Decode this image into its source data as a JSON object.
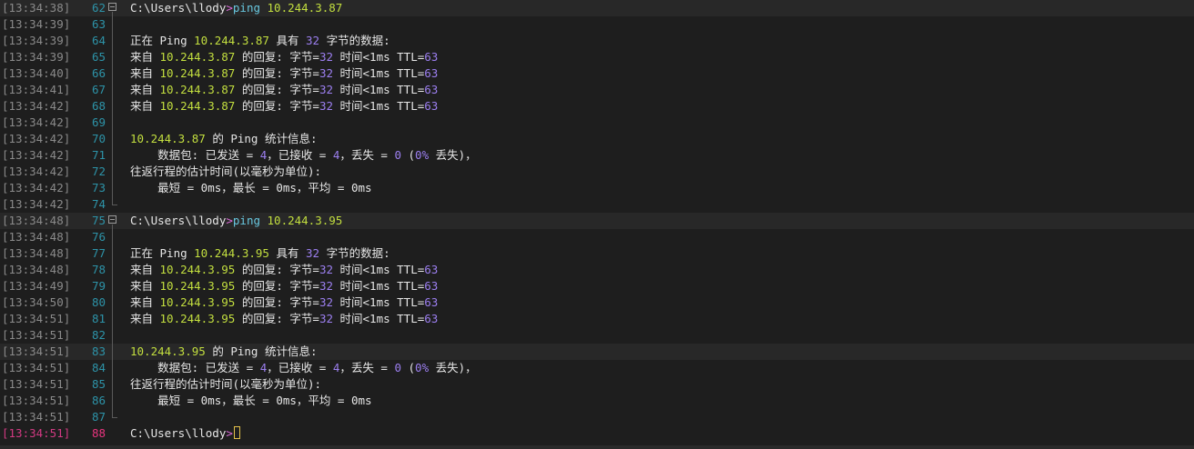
{
  "colors": {
    "background": "#1e1e1e",
    "timestamp": "#8a8a8a",
    "line_number": "#2d93a8",
    "current_line": "#e8347e",
    "text": "#e6e6e6",
    "ip_green": "#c3df3f",
    "prompt_pink": "#d96ad8",
    "command_cyan": "#68c7df",
    "number_purple": "#9c7ff0"
  },
  "lines": [
    {
      "ts": "[13:34:38]",
      "num": "62",
      "fold": "start",
      "hl": true,
      "tokens": [
        {
          "t": "C:\\Users\\llody",
          "c": "w"
        },
        {
          "t": ">",
          "c": "p"
        },
        {
          "t": "ping ",
          "c": "c"
        },
        {
          "t": "10.244.3.87",
          "c": "g"
        }
      ]
    },
    {
      "ts": "[13:34:39]",
      "num": "63",
      "fold": "bar",
      "tokens": []
    },
    {
      "ts": "[13:34:39]",
      "num": "64",
      "fold": "bar",
      "tokens": [
        {
          "t": "正在 Ping ",
          "c": "w"
        },
        {
          "t": "10.244.3.87",
          "c": "g"
        },
        {
          "t": " 具有 ",
          "c": "w"
        },
        {
          "t": "32",
          "c": "l"
        },
        {
          "t": " 字节的数据:",
          "c": "w"
        }
      ]
    },
    {
      "ts": "[13:34:39]",
      "num": "65",
      "fold": "bar",
      "tokens": [
        {
          "t": "来自 ",
          "c": "w"
        },
        {
          "t": "10.244.3.87",
          "c": "g"
        },
        {
          "t": " 的回复: 字节=",
          "c": "w"
        },
        {
          "t": "32",
          "c": "l"
        },
        {
          "t": " 时间<1ms TTL=",
          "c": "w"
        },
        {
          "t": "63",
          "c": "l"
        }
      ]
    },
    {
      "ts": "[13:34:40]",
      "num": "66",
      "fold": "bar",
      "tokens": [
        {
          "t": "来自 ",
          "c": "w"
        },
        {
          "t": "10.244.3.87",
          "c": "g"
        },
        {
          "t": " 的回复: 字节=",
          "c": "w"
        },
        {
          "t": "32",
          "c": "l"
        },
        {
          "t": " 时间<1ms TTL=",
          "c": "w"
        },
        {
          "t": "63",
          "c": "l"
        }
      ]
    },
    {
      "ts": "[13:34:41]",
      "num": "67",
      "fold": "bar",
      "tokens": [
        {
          "t": "来自 ",
          "c": "w"
        },
        {
          "t": "10.244.3.87",
          "c": "g"
        },
        {
          "t": " 的回复: 字节=",
          "c": "w"
        },
        {
          "t": "32",
          "c": "l"
        },
        {
          "t": " 时间<1ms TTL=",
          "c": "w"
        },
        {
          "t": "63",
          "c": "l"
        }
      ]
    },
    {
      "ts": "[13:34:42]",
      "num": "68",
      "fold": "bar",
      "tokens": [
        {
          "t": "来自 ",
          "c": "w"
        },
        {
          "t": "10.244.3.87",
          "c": "g"
        },
        {
          "t": " 的回复: 字节=",
          "c": "w"
        },
        {
          "t": "32",
          "c": "l"
        },
        {
          "t": " 时间<1ms TTL=",
          "c": "w"
        },
        {
          "t": "63",
          "c": "l"
        }
      ]
    },
    {
      "ts": "[13:34:42]",
      "num": "69",
      "fold": "bar",
      "tokens": []
    },
    {
      "ts": "[13:34:42]",
      "num": "70",
      "fold": "bar",
      "tokens": [
        {
          "t": "10.244.3.87",
          "c": "g"
        },
        {
          "t": " 的 Ping 统计信息:",
          "c": "w"
        }
      ]
    },
    {
      "ts": "[13:34:42]",
      "num": "71",
      "fold": "bar",
      "tokens": [
        {
          "t": "    数据包: 已发送 = ",
          "c": "w"
        },
        {
          "t": "4",
          "c": "l"
        },
        {
          "t": "，已接收 = ",
          "c": "w"
        },
        {
          "t": "4",
          "c": "l"
        },
        {
          "t": "，丢失 = ",
          "c": "w"
        },
        {
          "t": "0",
          "c": "l"
        },
        {
          "t": " (",
          "c": "w"
        },
        {
          "t": "0%",
          "c": "l"
        },
        {
          "t": " 丢失)，",
          "c": "w"
        }
      ]
    },
    {
      "ts": "[13:34:42]",
      "num": "72",
      "fold": "bar",
      "tokens": [
        {
          "t": "往返行程的估计时间(以毫秒为单位):",
          "c": "w"
        }
      ]
    },
    {
      "ts": "[13:34:42]",
      "num": "73",
      "fold": "bar",
      "tokens": [
        {
          "t": "    最短 = 0ms，最长 = 0ms，平均 = 0ms",
          "c": "w"
        }
      ]
    },
    {
      "ts": "[13:34:42]",
      "num": "74",
      "fold": "end",
      "tokens": []
    },
    {
      "ts": "[13:34:48]",
      "num": "75",
      "fold": "start",
      "hl": true,
      "tokens": [
        {
          "t": "C:\\Users\\llody",
          "c": "w"
        },
        {
          "t": ">",
          "c": "p"
        },
        {
          "t": "ping ",
          "c": "c"
        },
        {
          "t": "10.244.3.95",
          "c": "g"
        }
      ]
    },
    {
      "ts": "[13:34:48]",
      "num": "76",
      "fold": "bar",
      "tokens": []
    },
    {
      "ts": "[13:34:48]",
      "num": "77",
      "fold": "bar",
      "tokens": [
        {
          "t": "正在 Ping ",
          "c": "w"
        },
        {
          "t": "10.244.3.95",
          "c": "g"
        },
        {
          "t": " 具有 ",
          "c": "w"
        },
        {
          "t": "32",
          "c": "l"
        },
        {
          "t": " 字节的数据:",
          "c": "w"
        }
      ]
    },
    {
      "ts": "[13:34:48]",
      "num": "78",
      "fold": "bar",
      "tokens": [
        {
          "t": "来自 ",
          "c": "w"
        },
        {
          "t": "10.244.3.95",
          "c": "g"
        },
        {
          "t": " 的回复: 字节=",
          "c": "w"
        },
        {
          "t": "32",
          "c": "l"
        },
        {
          "t": " 时间<1ms TTL=",
          "c": "w"
        },
        {
          "t": "63",
          "c": "l"
        }
      ]
    },
    {
      "ts": "[13:34:49]",
      "num": "79",
      "fold": "bar",
      "tokens": [
        {
          "t": "来自 ",
          "c": "w"
        },
        {
          "t": "10.244.3.95",
          "c": "g"
        },
        {
          "t": " 的回复: 字节=",
          "c": "w"
        },
        {
          "t": "32",
          "c": "l"
        },
        {
          "t": " 时间<1ms TTL=",
          "c": "w"
        },
        {
          "t": "63",
          "c": "l"
        }
      ]
    },
    {
      "ts": "[13:34:50]",
      "num": "80",
      "fold": "bar",
      "tokens": [
        {
          "t": "来自 ",
          "c": "w"
        },
        {
          "t": "10.244.3.95",
          "c": "g"
        },
        {
          "t": " 的回复: 字节=",
          "c": "w"
        },
        {
          "t": "32",
          "c": "l"
        },
        {
          "t": " 时间<1ms TTL=",
          "c": "w"
        },
        {
          "t": "63",
          "c": "l"
        }
      ]
    },
    {
      "ts": "[13:34:51]",
      "num": "81",
      "fold": "bar",
      "tokens": [
        {
          "t": "来自 ",
          "c": "w"
        },
        {
          "t": "10.244.3.95",
          "c": "g"
        },
        {
          "t": " 的回复: 字节=",
          "c": "w"
        },
        {
          "t": "32",
          "c": "l"
        },
        {
          "t": " 时间<1ms TTL=",
          "c": "w"
        },
        {
          "t": "63",
          "c": "l"
        }
      ]
    },
    {
      "ts": "[13:34:51]",
      "num": "82",
      "fold": "bar",
      "tokens": []
    },
    {
      "ts": "[13:34:51]",
      "num": "83",
      "fold": "bar",
      "hl": true,
      "tokens": [
        {
          "t": "10.244.3.95",
          "c": "g"
        },
        {
          "t": " 的 Ping 统计信息:",
          "c": "w"
        }
      ]
    },
    {
      "ts": "[13:34:51]",
      "num": "84",
      "fold": "bar",
      "tokens": [
        {
          "t": "    数据包: 已发送 = ",
          "c": "w"
        },
        {
          "t": "4",
          "c": "l"
        },
        {
          "t": "，已接收 = ",
          "c": "w"
        },
        {
          "t": "4",
          "c": "l"
        },
        {
          "t": "，丢失 = ",
          "c": "w"
        },
        {
          "t": "0",
          "c": "l"
        },
        {
          "t": " (",
          "c": "w"
        },
        {
          "t": "0%",
          "c": "l"
        },
        {
          "t": " 丢失)，",
          "c": "w"
        }
      ]
    },
    {
      "ts": "[13:34:51]",
      "num": "85",
      "fold": "bar",
      "tokens": [
        {
          "t": "往返行程的估计时间(以毫秒为单位):",
          "c": "w"
        }
      ]
    },
    {
      "ts": "[13:34:51]",
      "num": "86",
      "fold": "bar",
      "tokens": [
        {
          "t": "    最短 = 0ms，最长 = 0ms，平均 = 0ms",
          "c": "w"
        }
      ]
    },
    {
      "ts": "[13:34:51]",
      "num": "87",
      "fold": "end",
      "tokens": []
    },
    {
      "ts": "[13:34:51]",
      "num": "88",
      "fold": "none",
      "current": true,
      "cursor": true,
      "tokens": [
        {
          "t": "C:\\Users\\llody",
          "c": "w"
        },
        {
          "t": ">",
          "c": "p"
        }
      ]
    }
  ]
}
